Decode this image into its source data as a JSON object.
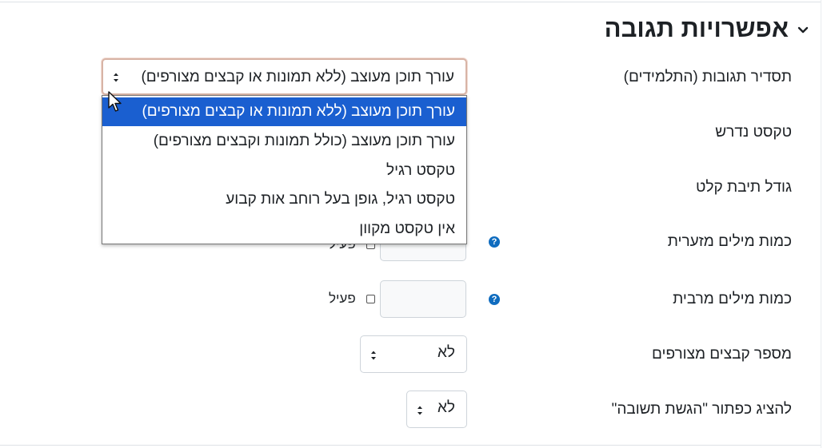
{
  "section": {
    "title": "אפשרויות תגובה",
    "toggle_icon": "chevron-down-icon"
  },
  "fields": {
    "response_format": {
      "label": "תסדיר תגובות (התלמידים)",
      "selected": "עורך תוכן מעוצב (ללא תמונות או קבצים מצורפים)",
      "options": [
        "עורך תוכן מעוצב (ללא תמונות או קבצים מצורפים)",
        "עורך תוכן מעוצב (כולל תמונות וקבצים מצורפים)",
        "טקסט רגיל",
        "טקסט רגיל, גופן בעל רוחב אות קבוע",
        "אין טקסט מקוון"
      ]
    },
    "required_text": {
      "label": "טקסט נדרש"
    },
    "input_box_size": {
      "label": "גודל תיבת קלט"
    },
    "min_words": {
      "label": "כמות מילים מזערית",
      "enable_label": "פעיל",
      "enabled": false,
      "help_icon": "question-circle-icon"
    },
    "max_words": {
      "label": "כמות מילים מרבית",
      "enable_label": "פעיל",
      "enabled": false,
      "help_icon": "question-circle-icon"
    },
    "attachments": {
      "label": "מספר קבצים מצורפים",
      "selected": "לא"
    },
    "submit_button": {
      "label": "להציג כפתור \"הגשת תשובה\"",
      "selected": "לא"
    }
  },
  "help_glyph": "?"
}
